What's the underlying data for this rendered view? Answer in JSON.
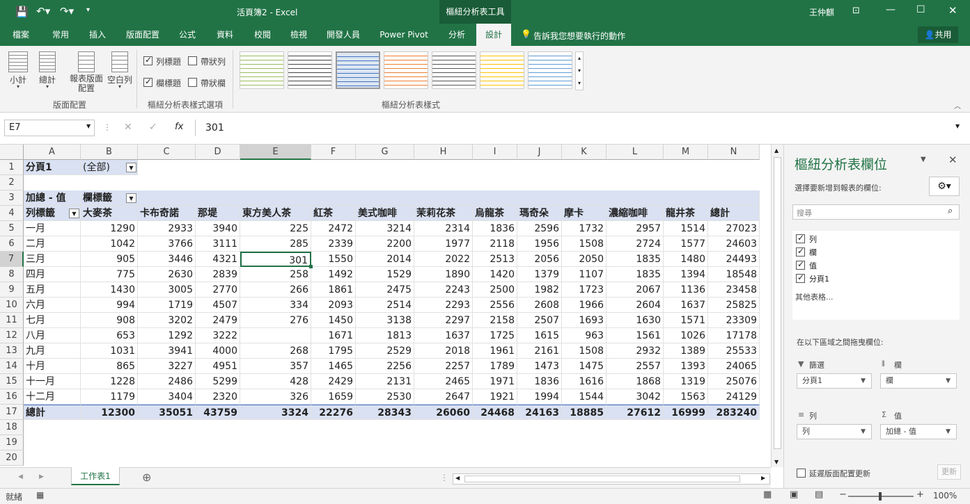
{
  "titlebar": {
    "title": "活頁簿2  -  Excel",
    "tools_context": "樞紐分析表工具",
    "user": "王仲麒"
  },
  "tabs": [
    "檔案",
    "常用",
    "插入",
    "版面配置",
    "公式",
    "資料",
    "校閱",
    "檢視",
    "開發人員",
    "Power Pivot",
    "分析",
    "設計"
  ],
  "tell_me": "告訴我您想要執行的動作",
  "share": "共用",
  "ribbon": {
    "subtotal": "小計",
    "grandtotal": "總計",
    "report_layout": "報表版面配置",
    "blank_rows": "空白列",
    "layout_group": "版面配置",
    "row_headers": "列標題",
    "col_headers": "欄標題",
    "banded_rows": "帶狀列",
    "banded_cols": "帶狀欄",
    "options_group": "樞紐分析表樣式選項",
    "styles_group": "樞紐分析表樣式"
  },
  "formula": {
    "namebox": "E7",
    "value": "301"
  },
  "columns": [
    "A",
    "B",
    "C",
    "D",
    "E",
    "F",
    "G",
    "H",
    "I",
    "J",
    "K",
    "L",
    "M",
    "N"
  ],
  "rows": [
    "1",
    "2",
    "3",
    "4",
    "5",
    "6",
    "7",
    "8",
    "9",
    "10",
    "11",
    "12",
    "13",
    "14",
    "15",
    "16",
    "17",
    "18",
    "19",
    "20"
  ],
  "pivot": {
    "filter_label": "分頁1",
    "filter_value": "(全部)",
    "values_label": "加總 - 值",
    "col_labels": "欄標籤",
    "row_labels": "列標籤",
    "headers": [
      "大麥茶",
      "卡布奇諾",
      "那堤",
      "東方美人茶",
      "紅茶",
      "美式咖啡",
      "茉莉花茶",
      "烏龍茶",
      "瑪奇朵",
      "摩卡",
      "濃縮咖啡",
      "龍井茶",
      "總計"
    ],
    "data": [
      [
        "一月",
        "1290",
        "2933",
        "3940",
        "225",
        "2472",
        "3214",
        "2314",
        "1836",
        "2596",
        "1732",
        "2957",
        "1514",
        "27023"
      ],
      [
        "二月",
        "1042",
        "3766",
        "3111",
        "285",
        "2339",
        "2200",
        "1977",
        "2118",
        "1956",
        "1508",
        "2724",
        "1577",
        "24603"
      ],
      [
        "三月",
        "905",
        "3446",
        "4321",
        "301",
        "1550",
        "2014",
        "2022",
        "2513",
        "2056",
        "2050",
        "1835",
        "1480",
        "24493"
      ],
      [
        "四月",
        "775",
        "2630",
        "2839",
        "258",
        "1492",
        "1529",
        "1890",
        "1420",
        "1379",
        "1107",
        "1835",
        "1394",
        "18548"
      ],
      [
        "五月",
        "1430",
        "3005",
        "2770",
        "266",
        "1861",
        "2475",
        "2243",
        "2500",
        "1982",
        "1723",
        "2067",
        "1136",
        "23458"
      ],
      [
        "六月",
        "994",
        "1719",
        "4507",
        "334",
        "2093",
        "2514",
        "2293",
        "2556",
        "2608",
        "1966",
        "2604",
        "1637",
        "25825"
      ],
      [
        "七月",
        "908",
        "3202",
        "2479",
        "276",
        "1450",
        "3138",
        "2297",
        "2158",
        "2507",
        "1693",
        "1630",
        "1571",
        "23309"
      ],
      [
        "八月",
        "653",
        "1292",
        "3222",
        "",
        "1671",
        "1813",
        "1637",
        "1725",
        "1615",
        "963",
        "1561",
        "1026",
        "17178"
      ],
      [
        "九月",
        "1031",
        "3941",
        "4000",
        "268",
        "1795",
        "2529",
        "2018",
        "1961",
        "2161",
        "1508",
        "2932",
        "1389",
        "25533"
      ],
      [
        "十月",
        "865",
        "3227",
        "4951",
        "357",
        "1465",
        "2256",
        "2257",
        "1789",
        "1473",
        "1475",
        "2557",
        "1393",
        "24065"
      ],
      [
        "十一月",
        "1228",
        "2486",
        "5299",
        "428",
        "2429",
        "2131",
        "2465",
        "1971",
        "1836",
        "1616",
        "1868",
        "1319",
        "25076"
      ],
      [
        "十二月",
        "1179",
        "3404",
        "2320",
        "326",
        "1659",
        "2530",
        "2647",
        "1921",
        "1994",
        "1544",
        "3042",
        "1563",
        "24129"
      ]
    ],
    "total_label": "總計",
    "totals": [
      "12300",
      "35051",
      "43759",
      "3324",
      "22276",
      "28343",
      "26060",
      "24468",
      "24163",
      "18885",
      "27612",
      "16999",
      "283240"
    ]
  },
  "sheet_tab": "工作表1",
  "status": {
    "ready": "就緒",
    "zoom": "100%"
  },
  "pane": {
    "title": "樞紐分析表欄位",
    "choose": "選擇要新增到報表的欄位:",
    "search_placeholder": "搜尋",
    "fields": [
      "列",
      "欄",
      "值",
      "分頁1"
    ],
    "more_tables": "其他表格...",
    "drag_label": "在以下區域之間拖曳欄位:",
    "filters_label": "篩選",
    "columns_label": "欄",
    "rows_label": "列",
    "values_label": "值",
    "filter_item": "分頁1",
    "column_item": "欄",
    "row_item": "列",
    "value_item": "加總 - 值",
    "defer": "延遲版面配置更新",
    "update": "更新"
  }
}
